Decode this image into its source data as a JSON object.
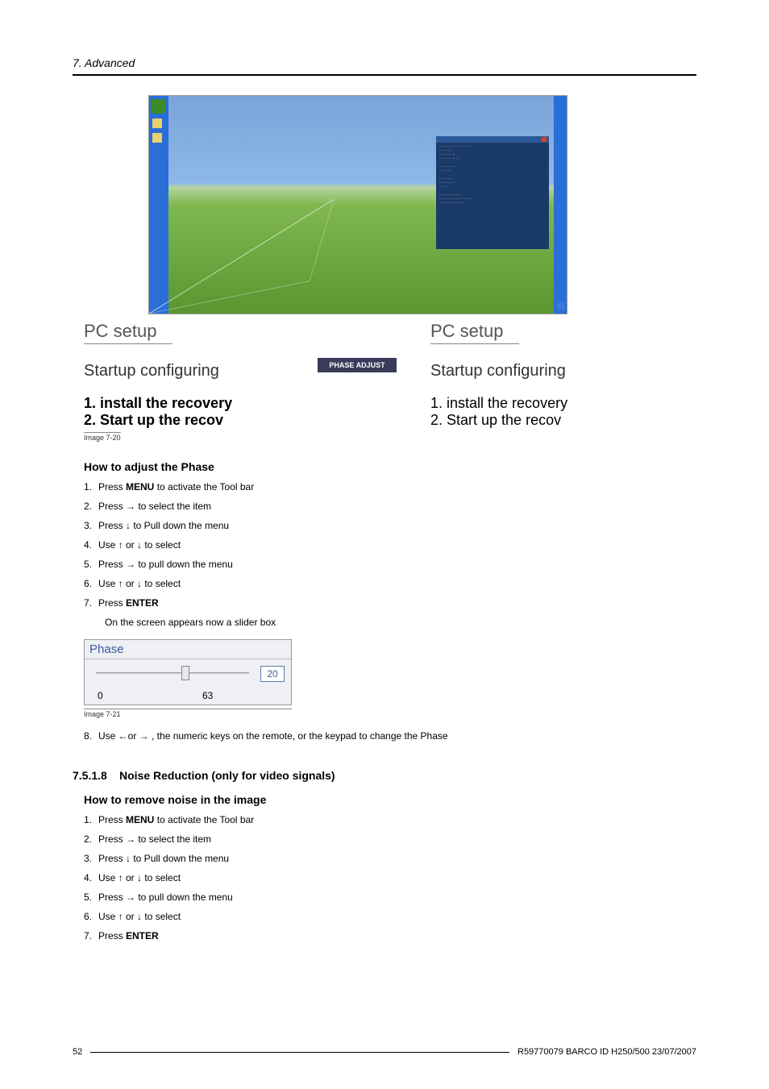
{
  "header": {
    "section": "7.  Advanced"
  },
  "figure": {
    "pc_setup": "PC setup",
    "startup_conf": "Startup configuring",
    "step1": "1. install the recovery",
    "step2": "2. Start up the recov",
    "phase_adjust": "PHASE ADJUST",
    "caption": "Image 7-20"
  },
  "phase_section": {
    "title": "How to adjust the Phase",
    "steps": {
      "s1a": "Press ",
      "s1b": "MENU",
      "s1c": " to activate the Tool bar",
      "s2": "Press → to select the           item",
      "s3": "Press ↓ to Pull down the           menu",
      "s4": "Use ↑ or ↓ to select",
      "s5": "Press → to pull down the menu",
      "s6": "Use ↑ or ↓ to select",
      "s7a": "Press ",
      "s7b": "ENTER",
      "result": "On the screen appears now a slider box",
      "s8": "Use ←or → , the numeric keys on the remote, or the keypad to change the Phase"
    },
    "slider": {
      "title": "Phase",
      "min": "0",
      "max": "63",
      "value": "20"
    },
    "slider_caption": "Image 7-21"
  },
  "noise_section": {
    "number": "7.5.1.8",
    "title": "Noise Reduction (only for video signals)",
    "subtitle": "How to remove noise in the image",
    "steps": {
      "s1a": "Press ",
      "s1b": "MENU",
      "s1c": " to activate the Tool bar",
      "s2": "Press → to select the           item",
      "s3": "Press ↓ to Pull down the           menu",
      "s4": "Use ↑ or ↓ to select",
      "s5": "Press → to pull down the menu",
      "s6": "Use ↑ or ↓ to select",
      "s7a": "Press ",
      "s7b": "ENTER"
    }
  },
  "footer": {
    "page": "52",
    "info": "R59770079  BARCO ID H250/500  23/07/2007"
  }
}
